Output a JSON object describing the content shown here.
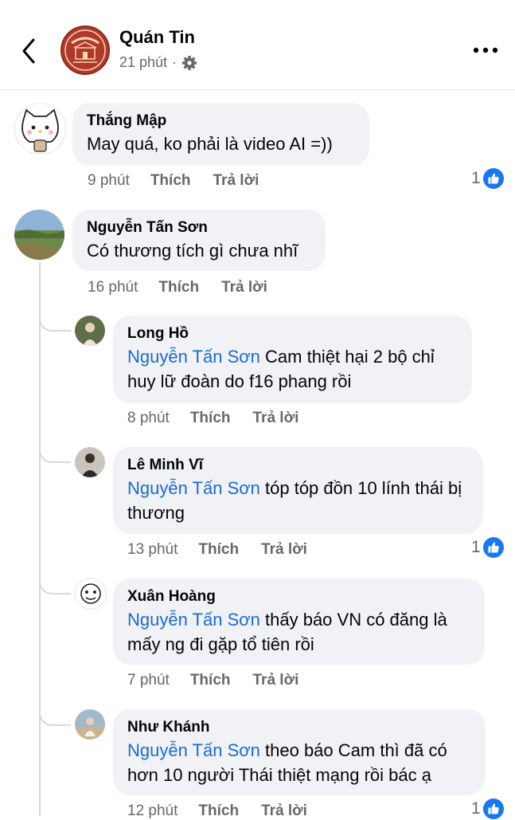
{
  "header": {
    "page_name": "Quán Tin",
    "time": "21 phút",
    "separator": "·"
  },
  "comments": [
    {
      "author": "Thắng Mập",
      "text": "May quá, ko phải là video AI =))",
      "time": "9 phút",
      "like": "Thích",
      "reply": "Trả lời",
      "reactions": "1"
    },
    {
      "author": "Nguyễn Tấn Sơn",
      "text": "Có thương tích gì chưa nhĩ",
      "time": "16 phút",
      "like": "Thích",
      "reply": "Trả lời"
    },
    {
      "author": "Long Hồ",
      "mention": "Nguyễn Tấn Sơn",
      "text": " Cam thiệt hại 2 bộ chỉ huy lữ đoàn do f16 phang rồi",
      "time": "8 phút",
      "like": "Thích",
      "reply": "Trả lời"
    },
    {
      "author": "Lê Minh Vĩ",
      "mention": "Nguyễn Tấn Sơn",
      "text": " tóp tóp đồn 10 lính thái bị thương",
      "time": "13 phút",
      "like": "Thích",
      "reply": "Trả lời",
      "reactions": "1"
    },
    {
      "author": "Xuân Hoàng",
      "mention": "Nguyễn Tấn Sơn",
      "text": " thấy báo VN có đăng là mấy ng đi gặp tổ tiên rồi",
      "time": "7 phút",
      "like": "Thích",
      "reply": "Trả lời"
    },
    {
      "author": "Như Khánh",
      "mention": "Nguyễn Tấn Sơn",
      "text": " theo báo Cam thì đã có hơn 10 người Thái thiệt mạng rồi bác ạ",
      "time": "12 phút",
      "like": "Thích",
      "reply": "Trả lời",
      "reactions": "1"
    }
  ],
  "icons": {
    "back": "chevron-left-icon",
    "settings": "gear-icon",
    "more": "more-horizontal-icon",
    "like": "like-icon"
  },
  "colors": {
    "mention": "#1b6bd6",
    "like_badge": "#1877f2",
    "bubble": "#f0f2f5",
    "brand": "#b2382b"
  }
}
